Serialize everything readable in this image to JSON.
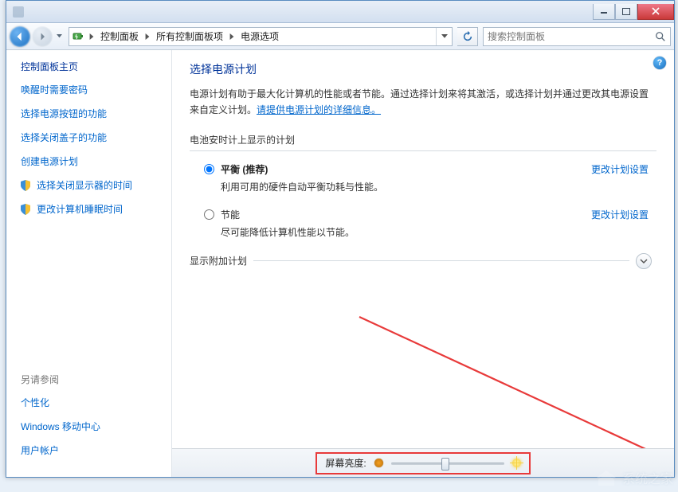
{
  "breadcrumb": {
    "item1": "控制面板",
    "item2": "所有控制面板项",
    "item3": "电源选项"
  },
  "search": {
    "placeholder": "搜索控制面板"
  },
  "sidebar": {
    "title": "控制面板主页",
    "links": [
      "唤醒时需要密码",
      "选择电源按钮的功能",
      "选择关闭盖子的功能",
      "创建电源计划",
      "选择关闭显示器的时间",
      "更改计算机睡眠时间"
    ]
  },
  "see_also": {
    "title": "另请参阅",
    "links": [
      "个性化",
      "Windows 移动中心",
      "用户帐户"
    ]
  },
  "page": {
    "title": "选择电源计划",
    "desc1": "电源计划有助于最大化计算机的性能或者节能。通过选择计划来将其激活，或选择计划并通过更改其电源设置来自定义计划。",
    "desc_link": "请提供电源计划的详细信息。"
  },
  "section1": {
    "label": "电池安时计上显示的计划"
  },
  "plans": [
    {
      "name_bold": "平衡 (推荐)",
      "desc": "利用可用的硬件自动平衡功耗与性能。",
      "link": "更改计划设置"
    },
    {
      "name_bold": "节能",
      "desc": "尽可能降低计算机性能以节能。",
      "link": "更改计划设置"
    }
  ],
  "section2": {
    "label": "显示附加计划"
  },
  "footer": {
    "brightness_label": "屏幕亮度:"
  },
  "watermark": "系统之家"
}
